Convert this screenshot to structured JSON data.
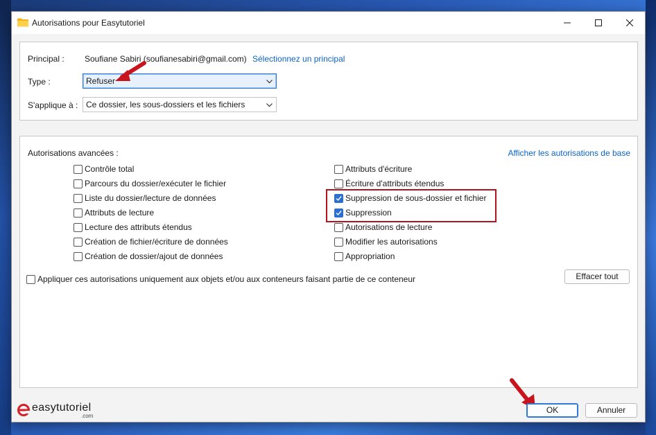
{
  "window": {
    "title": "Autorisations pour Easytutoriel"
  },
  "principal": {
    "label": "Principal :",
    "value": "Soufiane Sabiri (soufianesabiri@gmail.com)",
    "select_link": "Sélectionnez un principal"
  },
  "type": {
    "label": "Type :",
    "value": "Refuser"
  },
  "applies_to": {
    "label": "S'applique à :",
    "value": "Ce dossier, les sous-dossiers et les fichiers"
  },
  "advanced": {
    "label": "Autorisations avancées :",
    "basic_link": "Afficher les autorisations de base",
    "left_column": [
      {
        "label": "Contrôle total",
        "checked": false
      },
      {
        "label": "Parcours du dossier/exécuter le fichier",
        "checked": false
      },
      {
        "label": "Liste du dossier/lecture de données",
        "checked": false
      },
      {
        "label": "Attributs de lecture",
        "checked": false
      },
      {
        "label": "Lecture des attributs étendus",
        "checked": false
      },
      {
        "label": "Création de fichier/écriture de données",
        "checked": false
      },
      {
        "label": "Création de dossier/ajout de données",
        "checked": false
      }
    ],
    "right_column": [
      {
        "label": "Attributs d'écriture",
        "checked": false
      },
      {
        "label": "Écriture d'attributs étendus",
        "checked": false
      },
      {
        "label": "Suppression de sous-dossier et fichier",
        "checked": true
      },
      {
        "label": "Suppression",
        "checked": true
      },
      {
        "label": "Autorisations de lecture",
        "checked": false
      },
      {
        "label": "Modifier les autorisations",
        "checked": false
      },
      {
        "label": "Appropriation",
        "checked": false
      }
    ],
    "apply_only": {
      "label": "Appliquer ces autorisations uniquement aux objets et/ou aux conteneurs faisant partie de ce conteneur",
      "checked": false
    },
    "clear_all": "Effacer tout"
  },
  "footer": {
    "ok": "OK",
    "cancel": "Annuler",
    "logo_text": "easytutoriel",
    "logo_sub": ".com"
  },
  "colors": {
    "accent": "#2a6fd1",
    "link": "#0a64c8",
    "annotation_red": "#b3121f"
  }
}
